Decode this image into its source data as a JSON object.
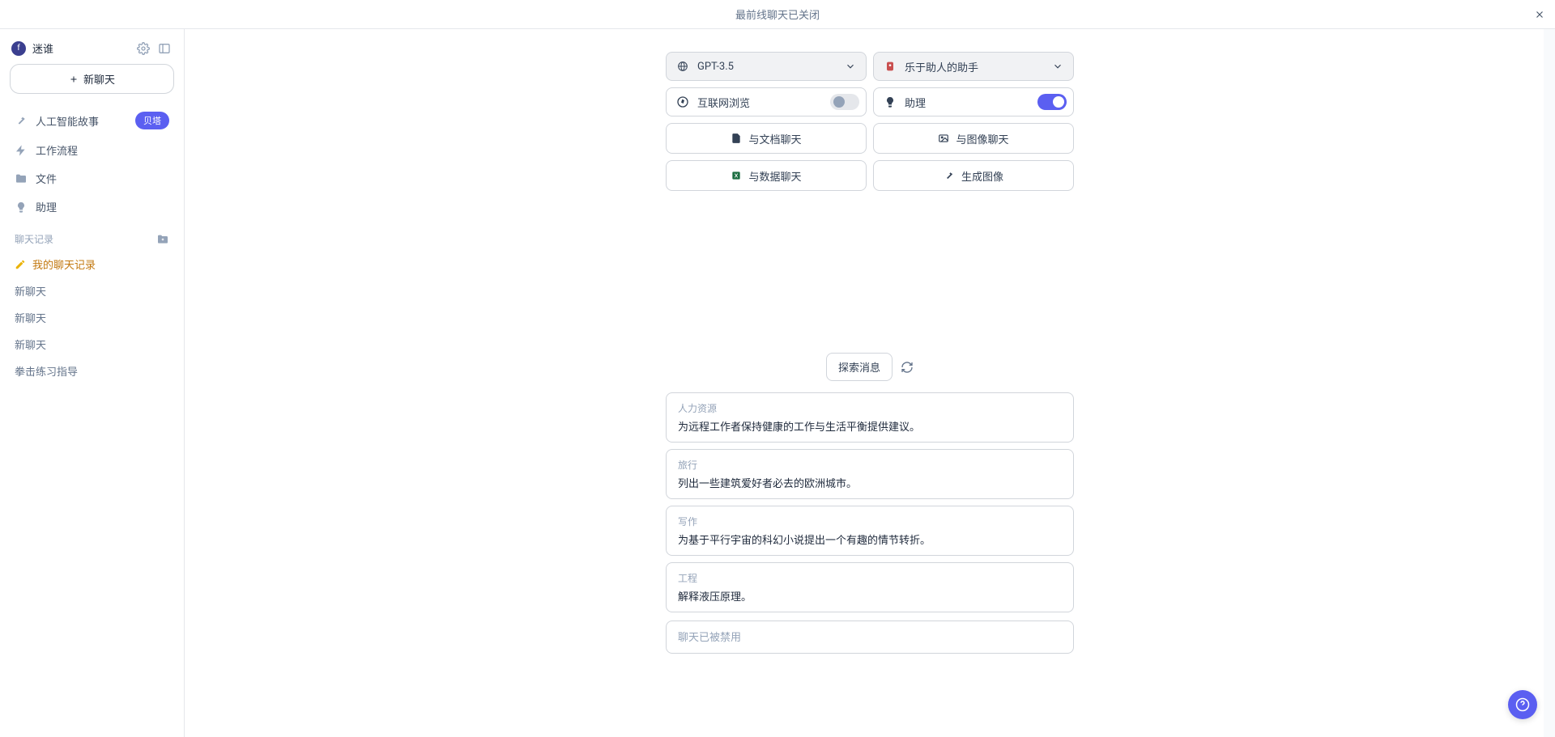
{
  "titlebar": {
    "title": "最前线聊天已关闭"
  },
  "sidebar": {
    "username": "迷谁",
    "avatar_initial": "f",
    "new_chat": "新聊天",
    "nav": [
      {
        "icon": "wand",
        "label": "人工智能故事",
        "beta": "贝塔"
      },
      {
        "icon": "bolt",
        "label": "工作流程"
      },
      {
        "icon": "folder",
        "label": "文件"
      },
      {
        "icon": "bulb",
        "label": "助理"
      }
    ],
    "history_header": "聊天记录",
    "history": [
      {
        "label": "我的聊天记录",
        "active": true,
        "icon": true
      },
      {
        "label": "新聊天"
      },
      {
        "label": "新聊天"
      },
      {
        "label": "新聊天"
      },
      {
        "label": "拳击练习指导"
      }
    ]
  },
  "config": {
    "model": {
      "label": "GPT-3.5"
    },
    "persona": {
      "label": "乐于助人的助手"
    },
    "browse": {
      "label": "互联网浏览",
      "on": false
    },
    "assist": {
      "label": "助理",
      "on": true
    },
    "btns": {
      "doc": "与文档聊天",
      "image": "与图像聊天",
      "data": "与数据聊天",
      "genimg": "生成图像"
    }
  },
  "explore": {
    "label": "探索消息"
  },
  "prompts": [
    {
      "cat": "人力资源",
      "text": "为远程工作者保持健康的工作与生活平衡提供建议。"
    },
    {
      "cat": "旅行",
      "text": "列出一些建筑爱好者必去的欧洲城市。"
    },
    {
      "cat": "写作",
      "text": "为基于平行宇宙的科幻小说提出一个有趣的情节转折。"
    },
    {
      "cat": "工程",
      "text": "解释液压原理。"
    }
  ],
  "input": {
    "placeholder": "聊天已被禁用"
  }
}
